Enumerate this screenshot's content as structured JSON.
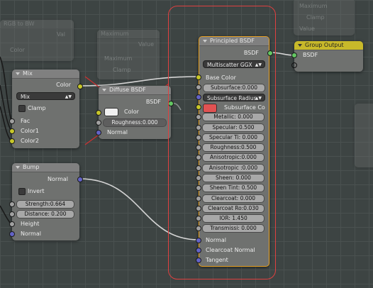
{
  "background_ghost": {
    "rgb_node": {
      "title": "RGB to BW",
      "val_label": "Val",
      "color_label": "Color"
    },
    "math_node": {
      "title": "Maximum",
      "value_label": "Value",
      "op_label": "Maximum",
      "clamp_label": "Clamp"
    },
    "top_right_node": {
      "op_label": "Maximum",
      "clamp_label": "Clamp",
      "value_label": "Value"
    }
  },
  "mix_node": {
    "title": "Mix",
    "output_color": "Color",
    "blend_mode": "Mix",
    "clamp": "Clamp",
    "fac": "Fac",
    "color1": "Color1",
    "color2": "Color2"
  },
  "diffuse_node": {
    "title": "Diffuse BSDF",
    "output": "BSDF",
    "color": "Color",
    "roughness": "Roughness:0.000",
    "normal": "Normal"
  },
  "bump_node": {
    "title": "Bump",
    "output": "Normal",
    "invert": "Invert",
    "strength": "Strength:0.664",
    "distance": "Distance: 0.200",
    "height": "Height",
    "normal": "Normal"
  },
  "principled_node": {
    "title": "Principled BSDF",
    "output": "BSDF",
    "distribution": "Multiscatter GGX",
    "base_color": "Base Color",
    "subsurface": "Subsurface:0.000",
    "subsurface_radius": "Subsurface Radius",
    "subsurface_color": "Subsurface Co",
    "metallic": {
      "label": "Metallic:",
      "value": "0.000"
    },
    "specular": {
      "label": "Specular:",
      "value": "0.500"
    },
    "specular_tint": {
      "label": "Specular Ti:",
      "value": "0.000"
    },
    "roughness": {
      "label": "Roughness:",
      "value": "0.500"
    },
    "anisotropic": {
      "label": "Anisotropic:",
      "value": "0.000"
    },
    "anisotropic_rot": {
      "label": "Anisotropic :",
      "value": "0.000"
    },
    "sheen": {
      "label": "Sheen:",
      "value": "0.000"
    },
    "sheen_tint": {
      "label": "Sheen Tint:",
      "value": "0.500"
    },
    "clearcoat": {
      "label": "Clearcoat:",
      "value": "0.000"
    },
    "clearcoat_rough": {
      "label": "Clearcoat Ro:",
      "value": "0.030"
    },
    "ior": {
      "label": "IOR:",
      "value": "1.450"
    },
    "transmission": {
      "label": "Transmissi:",
      "value": "0.000"
    },
    "normal": "Normal",
    "clearcoat_normal": "Clearcoat Normal",
    "tangent": "Tangent"
  },
  "group_output": {
    "title": "Group Output",
    "input": "BSDF"
  },
  "colors": {
    "socket_gray": "#a1a1a1",
    "socket_yellow": "#c7c729",
    "socket_blue": "#6363c7",
    "socket_green": "#63c763",
    "subsurface_swatch": "#e05252",
    "diffuse_swatch": "#f0f0f0",
    "highlight_outline": "#e04040",
    "group_header": "#c8b92a"
  }
}
